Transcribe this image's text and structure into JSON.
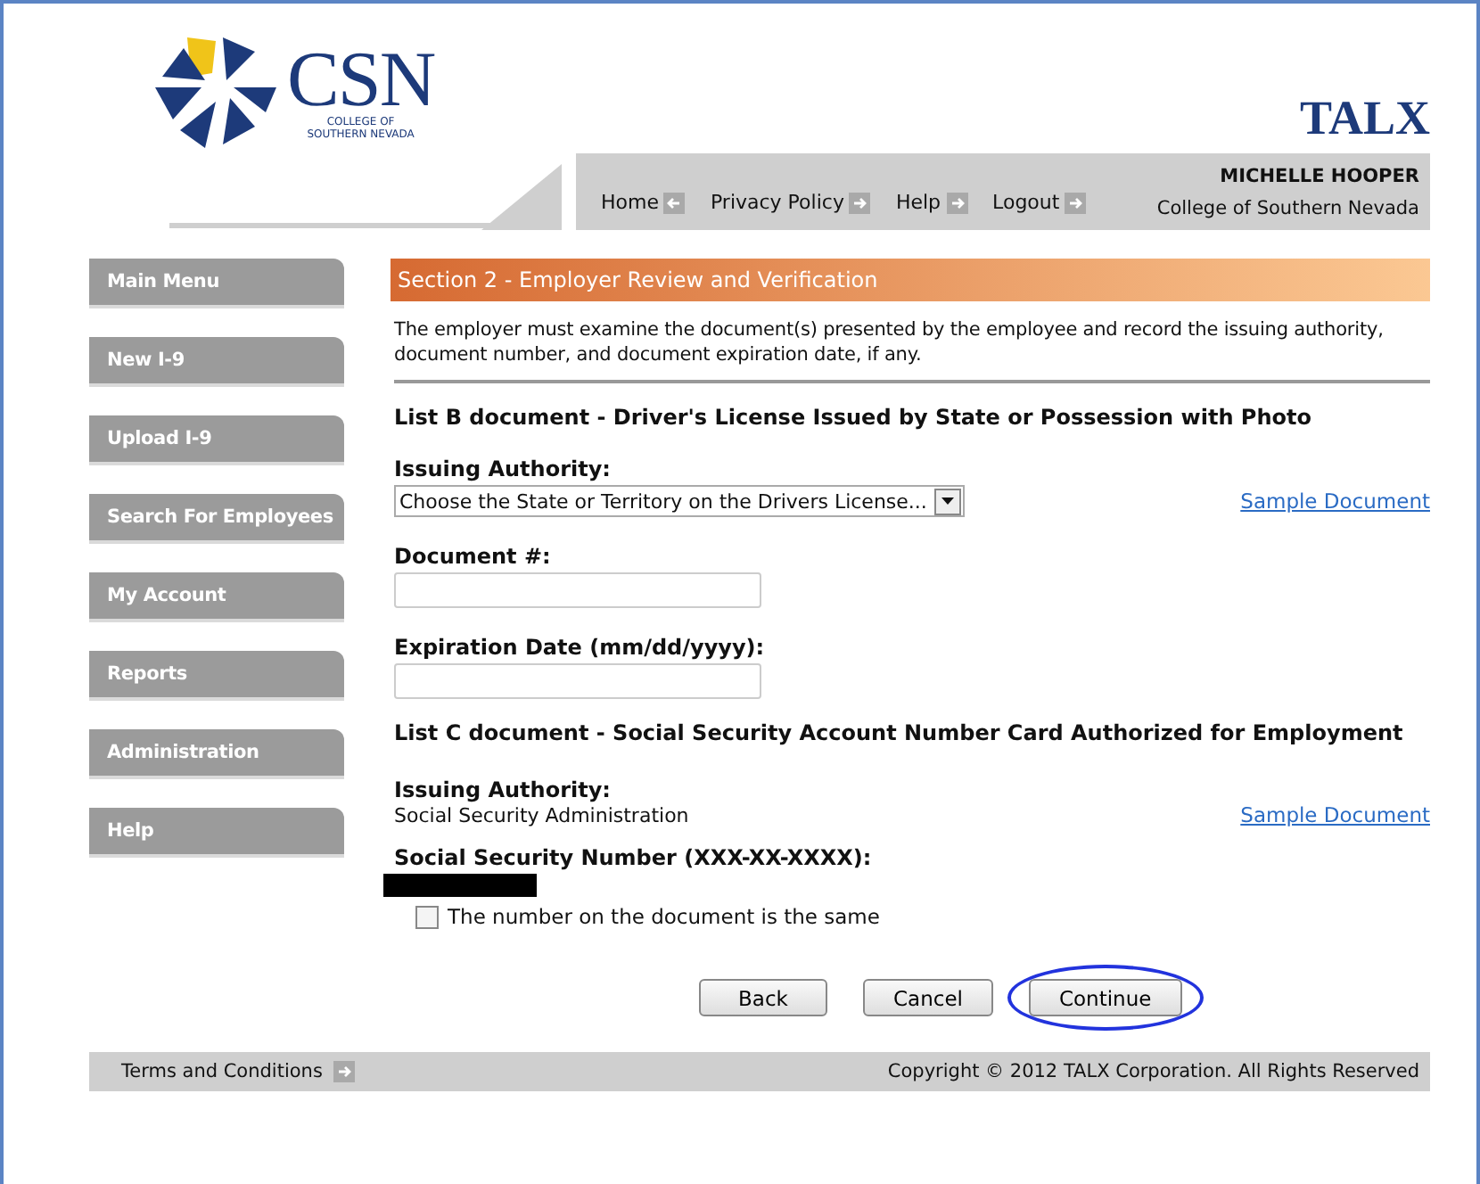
{
  "header": {
    "logo": {
      "mark": "CSN",
      "caption_1": "COLLEGE OF",
      "caption_2": "SOUTHERN NEVADA"
    },
    "brand": "TALX",
    "nav": [
      {
        "label": "Home"
      },
      {
        "label": "Privacy Policy"
      },
      {
        "label": "Help"
      },
      {
        "label": "Logout"
      }
    ],
    "user": {
      "name": "MICHELLE HOOPER",
      "organization": "College of Southern Nevada"
    }
  },
  "sidebar": {
    "items": [
      {
        "label": "Main Menu"
      },
      {
        "label": "New I-9"
      },
      {
        "label": "Upload I-9"
      },
      {
        "label": "Search For Employees"
      },
      {
        "label": "My Account"
      },
      {
        "label": "Reports"
      },
      {
        "label": "Administration"
      },
      {
        "label": "Help"
      }
    ]
  },
  "section": {
    "title": "Section 2 - Employer Review and Verification",
    "intro": "The employer must examine the document(s) presented by the employee and record the issuing authority, document number, and document expiration date, if any.",
    "list_b": {
      "heading": "List B document - Driver's License Issued by State or Possession with Photo",
      "authority_label": "Issuing Authority:",
      "authority_select": "Choose the State or Territory on the Drivers License...",
      "sample_link": "Sample Document",
      "document_label": "Document #:",
      "expiration_label": "Expiration Date (mm/dd/yyyy):"
    },
    "list_c": {
      "heading": "List C document - Social Security Account Number Card Authorized for Employment",
      "authority_label": "Issuing Authority:",
      "authority_value": "Social Security Administration",
      "sample_link": "Sample Document",
      "ssn_label": "Social Security Number (XXX-XX-XXXX):",
      "same_checkbox": {
        "label": "The number on the document is the same",
        "checked": false
      }
    },
    "buttons": [
      {
        "label": "Back",
        "circled": false
      },
      {
        "label": "Cancel",
        "circled": false
      },
      {
        "label": "Continue",
        "circled": true
      }
    ]
  },
  "footer": {
    "link": "Terms and Conditions",
    "copyright": "Copyright © 2012 TALX Corporation. All Rights Reserved"
  }
}
